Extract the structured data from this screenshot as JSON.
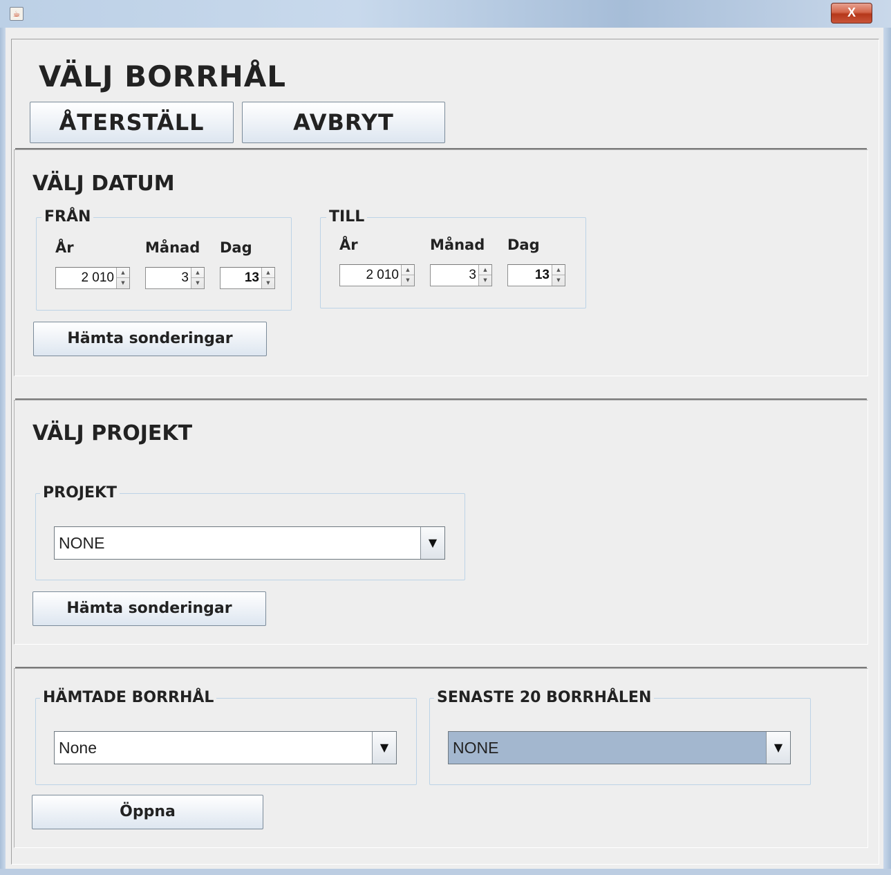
{
  "window": {
    "icon": "java-cup-icon",
    "close_label": "X"
  },
  "header": {
    "title": "VÄLJ BORRHÅL",
    "reset_label": "ÅTERSTÄLL",
    "cancel_label": "AVBRYT"
  },
  "date_section": {
    "title": "VÄLJ DATUM",
    "from": {
      "legend": "FRÅN",
      "year_label": "År",
      "month_label": "Månad",
      "day_label": "Dag",
      "year_value": "2 010",
      "month_value": "3",
      "day_value": "13"
    },
    "to": {
      "legend": "TILL",
      "year_label": "År",
      "month_label": "Månad",
      "day_label": "Dag",
      "year_value": "2 010",
      "month_value": "3",
      "day_value": "13"
    },
    "fetch_label": "Hämta sonderingar"
  },
  "project_section": {
    "title": "VÄLJ PROJEKT",
    "legend": "PROJEKT",
    "selected": "NONE",
    "fetch_label": "Hämta sonderingar"
  },
  "results_section": {
    "fetched_legend": "HÄMTADE BORRHÅL",
    "fetched_selected": "None",
    "recent_legend": "SENASTE 20 BORRHÅLEN",
    "recent_selected": "NONE",
    "open_label": "Öppna"
  }
}
